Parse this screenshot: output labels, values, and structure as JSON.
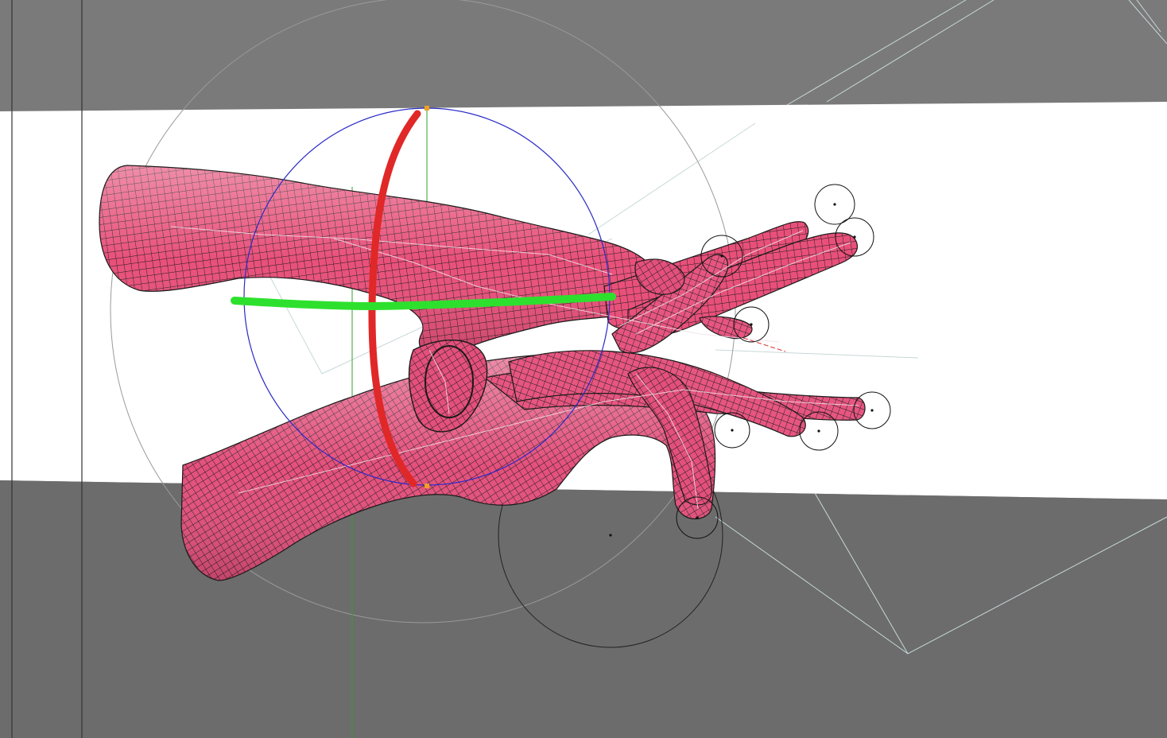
{
  "viewport": {
    "name": "3d-viewport",
    "background_top": "#7a7a7a",
    "background_bottom": "#6c6c6c",
    "backdrop_band": "#ffffff"
  },
  "model": {
    "name": "hands-wireframe-mesh",
    "shaded_color": "#e8507a",
    "highlight_color": "#ffb3c6",
    "wire_color": "#1a1a1a",
    "hands": [
      "upper-hand",
      "lower-hand"
    ]
  },
  "gizmo": {
    "type": "rotate",
    "x_axis_color": "#e02828",
    "y_axis_color": "#2ee02e",
    "view_ring_color": "#2a2ac8",
    "trackball_color": "#9a9a9a",
    "pivot_handle_color": "#f0a020"
  },
  "ik_handles": {
    "color": "#111111",
    "count": 8
  },
  "guides": {
    "line_color": "#c8d8d8",
    "green_guide_color": "#2fa02f"
  }
}
